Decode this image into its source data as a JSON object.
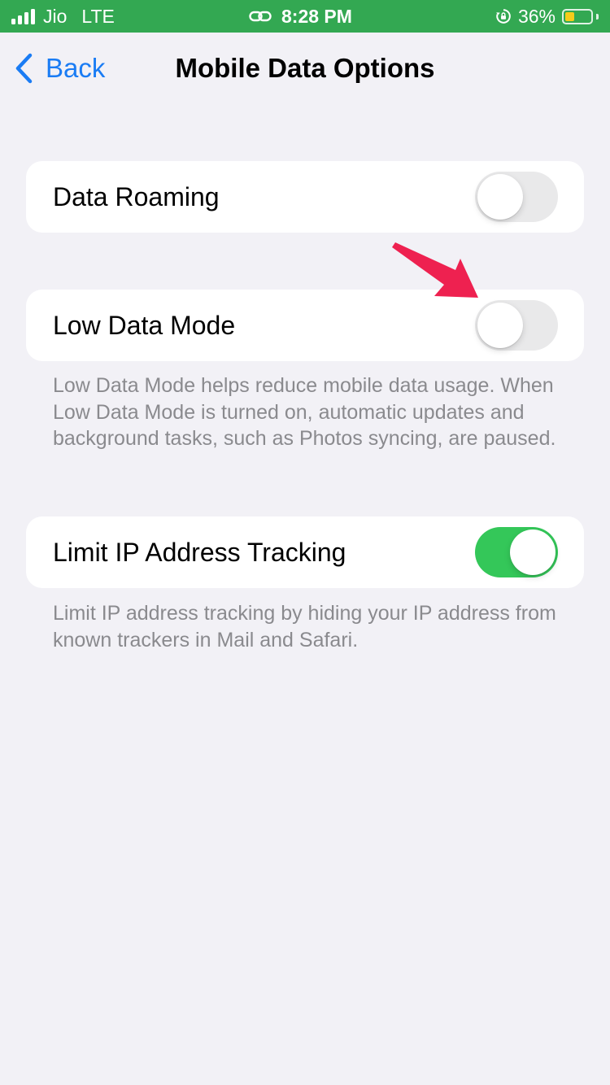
{
  "status_bar": {
    "carrier": "Jio",
    "network": "LTE",
    "time": "8:28 PM",
    "battery_percent": "36%",
    "battery_level": 0.36,
    "background_color": "#33a852",
    "icons": [
      "signal-bars-icon",
      "link-icon",
      "rotation-lock-icon",
      "battery-icon"
    ]
  },
  "nav": {
    "back_label": "Back",
    "title": "Mobile Data Options",
    "accent_color": "#1a7cf4"
  },
  "settings": [
    {
      "label": "Data Roaming",
      "enabled": false
    },
    {
      "label": "Low Data Mode",
      "enabled": false,
      "footer": "Low Data Mode helps reduce mobile data usage. When Low Data Mode is turned on, automatic updates and background tasks, such as Photos syncing, are paused."
    },
    {
      "label": "Limit IP Address Tracking",
      "enabled": true,
      "footer": "Limit IP address tracking by hiding your IP address from known trackers in Mail and Safari."
    }
  ],
  "colors": {
    "toggle_on": "#34c759",
    "toggle_off": "#e9e9ea",
    "annotation_arrow": "#ee2150",
    "page_background": "#f2f1f6"
  }
}
